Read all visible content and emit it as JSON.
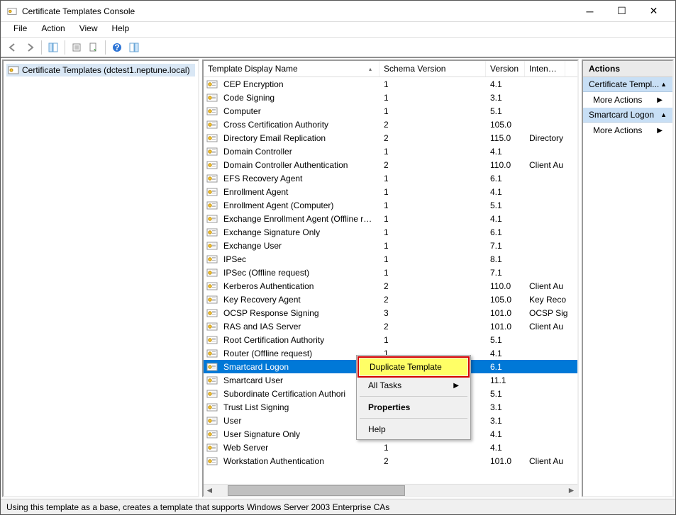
{
  "window": {
    "title": "Certificate Templates Console"
  },
  "menu": {
    "file": "File",
    "action": "Action",
    "view": "View",
    "help": "Help"
  },
  "left": {
    "node": "Certificate Templates (dctest1.neptune.local)"
  },
  "columns": {
    "name": "Template Display Name",
    "schema": "Schema Version",
    "version": "Version",
    "intended": "Intended"
  },
  "rows": [
    {
      "name": "CEP Encryption",
      "schema": "1",
      "version": "4.1",
      "intended": ""
    },
    {
      "name": "Code Signing",
      "schema": "1",
      "version": "3.1",
      "intended": ""
    },
    {
      "name": "Computer",
      "schema": "1",
      "version": "5.1",
      "intended": ""
    },
    {
      "name": "Cross Certification Authority",
      "schema": "2",
      "version": "105.0",
      "intended": ""
    },
    {
      "name": "Directory Email Replication",
      "schema": "2",
      "version": "115.0",
      "intended": "Directory"
    },
    {
      "name": "Domain Controller",
      "schema": "1",
      "version": "4.1",
      "intended": ""
    },
    {
      "name": "Domain Controller Authentication",
      "schema": "2",
      "version": "110.0",
      "intended": "Client Au"
    },
    {
      "name": "EFS Recovery Agent",
      "schema": "1",
      "version": "6.1",
      "intended": ""
    },
    {
      "name": "Enrollment Agent",
      "schema": "1",
      "version": "4.1",
      "intended": ""
    },
    {
      "name": "Enrollment Agent (Computer)",
      "schema": "1",
      "version": "5.1",
      "intended": ""
    },
    {
      "name": "Exchange Enrollment Agent (Offline requ...",
      "schema": "1",
      "version": "4.1",
      "intended": ""
    },
    {
      "name": "Exchange Signature Only",
      "schema": "1",
      "version": "6.1",
      "intended": ""
    },
    {
      "name": "Exchange User",
      "schema": "1",
      "version": "7.1",
      "intended": ""
    },
    {
      "name": "IPSec",
      "schema": "1",
      "version": "8.1",
      "intended": ""
    },
    {
      "name": "IPSec (Offline request)",
      "schema": "1",
      "version": "7.1",
      "intended": ""
    },
    {
      "name": "Kerberos Authentication",
      "schema": "2",
      "version": "110.0",
      "intended": "Client Au"
    },
    {
      "name": "Key Recovery Agent",
      "schema": "2",
      "version": "105.0",
      "intended": "Key Reco"
    },
    {
      "name": "OCSP Response Signing",
      "schema": "3",
      "version": "101.0",
      "intended": "OCSP Sig"
    },
    {
      "name": "RAS and IAS Server",
      "schema": "2",
      "version": "101.0",
      "intended": "Client Au"
    },
    {
      "name": "Root Certification Authority",
      "schema": "1",
      "version": "5.1",
      "intended": ""
    },
    {
      "name": "Router (Offline request)",
      "schema": "1",
      "version": "4.1",
      "intended": ""
    },
    {
      "name": "Smartcard Logon",
      "schema": "",
      "version": "6.1",
      "intended": "",
      "selected": true
    },
    {
      "name": "Smartcard User",
      "schema": "",
      "version": "11.1",
      "intended": ""
    },
    {
      "name": "Subordinate Certification Authori",
      "schema": "",
      "version": "5.1",
      "intended": ""
    },
    {
      "name": "Trust List Signing",
      "schema": "",
      "version": "3.1",
      "intended": ""
    },
    {
      "name": "User",
      "schema": "",
      "version": "3.1",
      "intended": ""
    },
    {
      "name": "User Signature Only",
      "schema": "",
      "version": "4.1",
      "intended": ""
    },
    {
      "name": "Web Server",
      "schema": "1",
      "version": "4.1",
      "intended": ""
    },
    {
      "name": "Workstation Authentication",
      "schema": "2",
      "version": "101.0",
      "intended": "Client Au"
    }
  ],
  "contextmenu": {
    "duplicate": "Duplicate Template",
    "alltasks": "All Tasks",
    "properties": "Properties",
    "help": "Help"
  },
  "actions": {
    "header": "Actions",
    "section1": "Certificate Templ...",
    "section2": "Smartcard Logon",
    "more": "More Actions"
  },
  "status": "Using this template as a base, creates a template that supports Windows Server 2003 Enterprise CAs"
}
